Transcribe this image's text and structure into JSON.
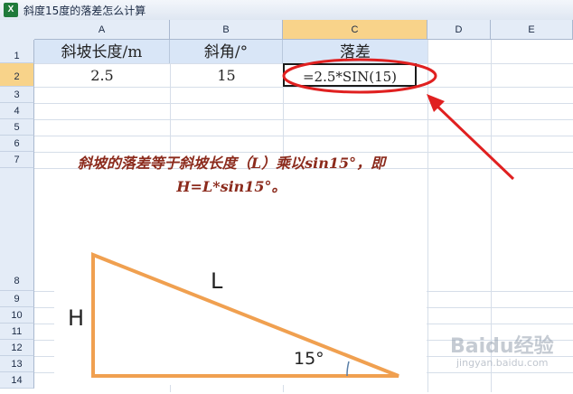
{
  "window": {
    "title": "斜度15度的落差怎么计算",
    "app_icon": "excel-icon"
  },
  "columns": [
    "A",
    "B",
    "C",
    "D",
    "E"
  ],
  "rows": [
    "1",
    "2",
    "3",
    "4",
    "5",
    "6",
    "7",
    "8",
    "9",
    "10",
    "11",
    "12",
    "13",
    "14"
  ],
  "cells": {
    "A1": "斜坡长度/m",
    "B1": "斜角/°",
    "C1": "落差",
    "A2": "2.5",
    "B2": "15",
    "C2": "=2.5*SIN(15)"
  },
  "note": "斜坡的落差等于斜坡长度（L）乘以sin15°，即H=L*sin15°。",
  "diagram": {
    "label_hyp": "L",
    "label_height": "H",
    "label_angle": "15°"
  },
  "watermark": {
    "text": "Baidu经验",
    "sub": "jingyan.baidu.com"
  },
  "colors": {
    "highlight_col": "#f8d38a",
    "triangle": "#f0a050",
    "annotation": "#e02020"
  }
}
